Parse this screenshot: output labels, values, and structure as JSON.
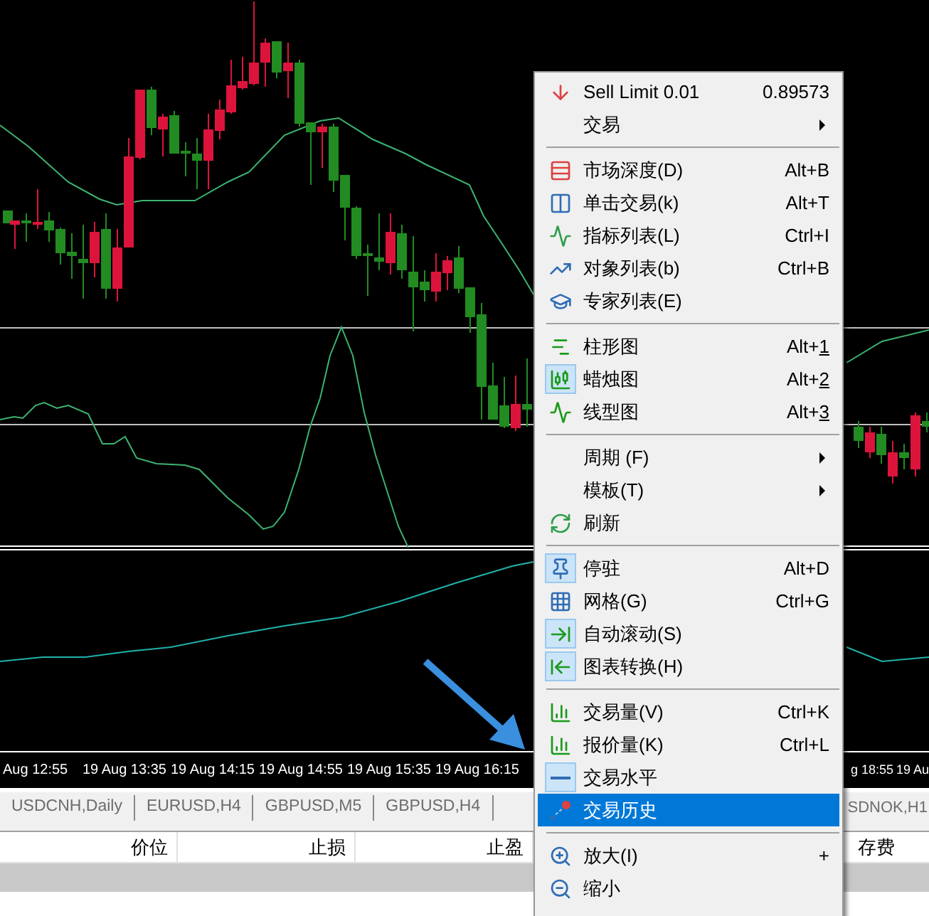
{
  "time_axis": {
    "left_labels": [
      "Aug 12:55",
      "19 Aug 13:35",
      "19 Aug 14:15",
      "19 Aug 14:55",
      "19 Aug 15:35",
      "19 Aug 16:15"
    ],
    "right_labels": [
      "g 18:55",
      "19 Au"
    ]
  },
  "chart_tabs": {
    "left": [
      {
        "label": "USDCNH,Daily",
        "selected": false
      },
      {
        "label": "EURUSD,H4",
        "selected": false
      },
      {
        "label": "GBPUSD,M5",
        "selected": false
      },
      {
        "label": "GBPUSD,H4",
        "selected": false
      }
    ],
    "right": [
      {
        "label": "SDNOK,H1",
        "selected": false
      }
    ]
  },
  "table": {
    "columns": [
      "价位",
      "止损",
      "止盈"
    ],
    "right_columns": [
      "存费"
    ]
  },
  "context_menu": {
    "items": [
      {
        "kind": "item",
        "label": "Sell Limit 0.01",
        "shortcut": "0.89573",
        "submenu": false,
        "checked": false,
        "selected": false
      },
      {
        "kind": "item",
        "label": "交易",
        "submenu": true,
        "checked": false,
        "selected": false
      },
      {
        "kind": "separator"
      },
      {
        "kind": "item",
        "label": "市场深度(D)",
        "shortcut": "Alt+B",
        "submenu": false,
        "checked": false,
        "selected": false
      },
      {
        "kind": "item",
        "label": "单击交易(k)",
        "shortcut": "Alt+T",
        "submenu": false,
        "checked": false,
        "selected": false
      },
      {
        "kind": "item",
        "label": "指标列表(L)",
        "shortcut": "Ctrl+I",
        "submenu": false,
        "checked": false,
        "selected": false
      },
      {
        "kind": "item",
        "label": "对象列表(b)",
        "shortcut": "Ctrl+B",
        "submenu": false,
        "checked": false,
        "selected": false
      },
      {
        "kind": "item",
        "label": "专家列表(E)",
        "submenu": false,
        "checked": false,
        "selected": false
      },
      {
        "kind": "separator"
      },
      {
        "kind": "item",
        "label": "柱形图",
        "shortcut": "Alt+",
        "shortcut_key": "1",
        "submenu": false,
        "checked": false,
        "selected": false
      },
      {
        "kind": "item",
        "label": "蜡烛图",
        "shortcut": "Alt+",
        "shortcut_key": "2",
        "submenu": false,
        "checked": true,
        "selected": false
      },
      {
        "kind": "item",
        "label": "线型图",
        "shortcut": "Alt+",
        "shortcut_key": "3",
        "submenu": false,
        "checked": false,
        "selected": false
      },
      {
        "kind": "separator"
      },
      {
        "kind": "item",
        "label": "周期 (F)",
        "submenu": true,
        "checked": false,
        "selected": false
      },
      {
        "kind": "item",
        "label": "模板(T)",
        "submenu": true,
        "checked": false,
        "selected": false
      },
      {
        "kind": "item",
        "label": "刷新",
        "submenu": false,
        "checked": false,
        "selected": false
      },
      {
        "kind": "separator"
      },
      {
        "kind": "item",
        "label": "停驻",
        "shortcut": "Alt+D",
        "submenu": false,
        "checked": true,
        "selected": false
      },
      {
        "kind": "item",
        "label": "网格(G)",
        "shortcut": "Ctrl+G",
        "submenu": false,
        "checked": false,
        "selected": false
      },
      {
        "kind": "item",
        "label": "自动滚动(S)",
        "submenu": false,
        "checked": true,
        "selected": false
      },
      {
        "kind": "item",
        "label": "图表转换(H)",
        "submenu": false,
        "checked": true,
        "selected": false
      },
      {
        "kind": "separator"
      },
      {
        "kind": "item",
        "label": "交易量(V)",
        "shortcut": "Ctrl+K",
        "submenu": false,
        "checked": false,
        "selected": false
      },
      {
        "kind": "item",
        "label": "报价量(K)",
        "shortcut": "Ctrl+L",
        "submenu": false,
        "checked": false,
        "selected": false
      },
      {
        "kind": "item",
        "label": "交易水平",
        "submenu": false,
        "checked": true,
        "selected": false
      },
      {
        "kind": "item",
        "label": "交易历史",
        "submenu": false,
        "checked": false,
        "selected": true
      },
      {
        "kind": "separator"
      },
      {
        "kind": "item",
        "label": "放大(I)",
        "shortcut": "+",
        "submenu": false,
        "checked": false,
        "selected": false
      },
      {
        "kind": "item",
        "label": "缩小",
        "submenu": false,
        "checked": false,
        "selected": false
      }
    ]
  }
}
